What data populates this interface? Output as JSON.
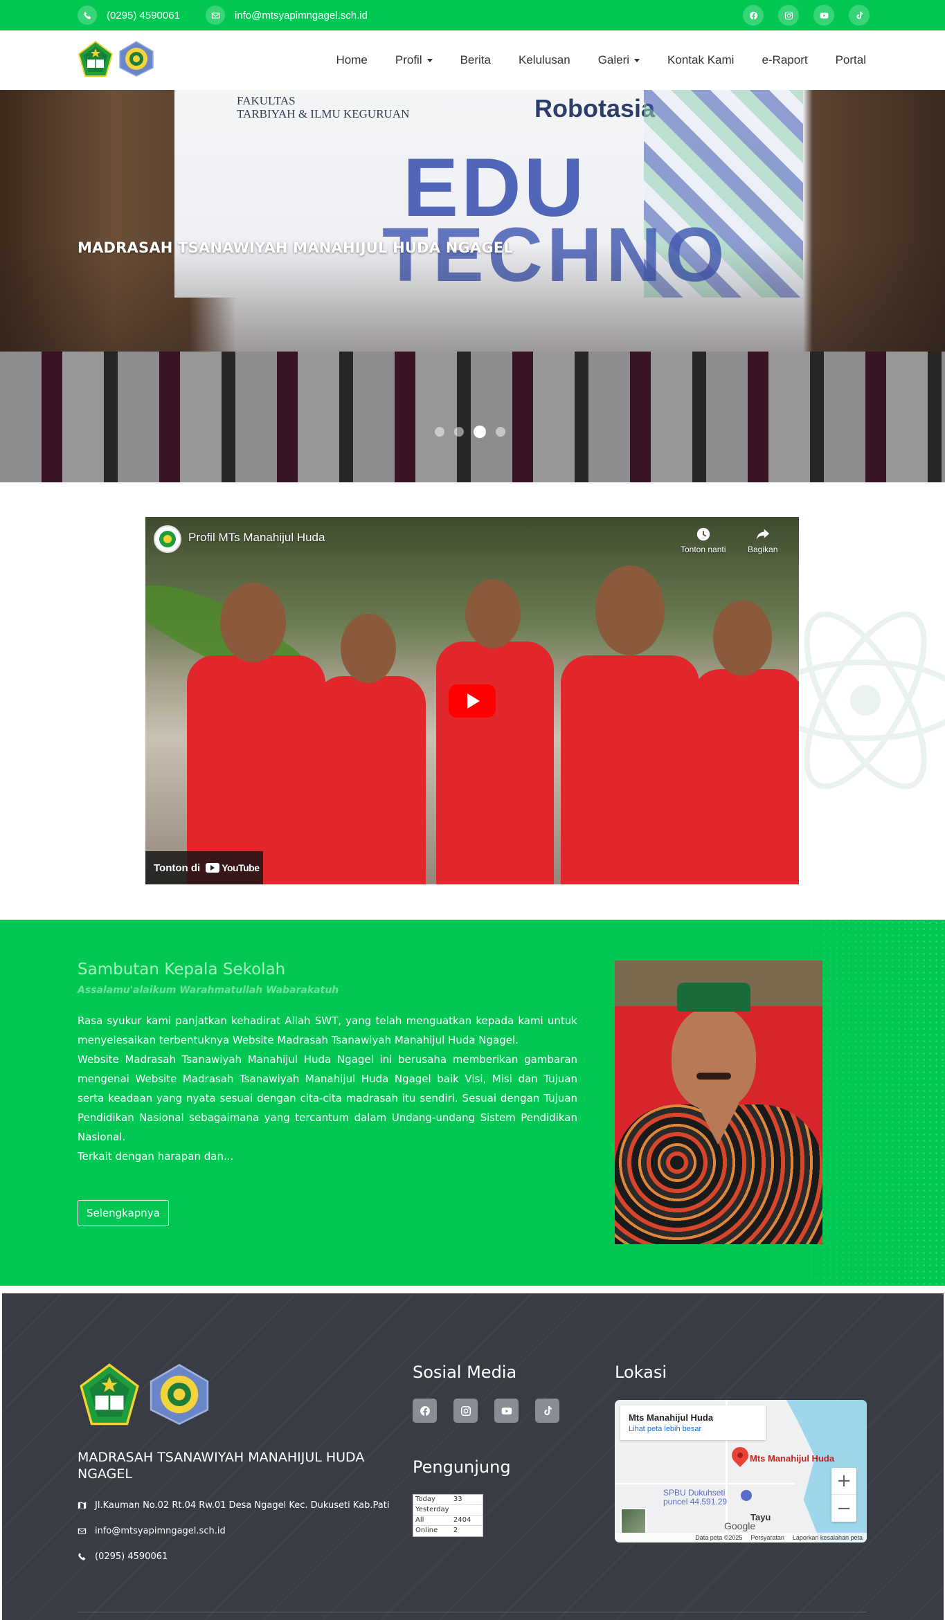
{
  "topbar": {
    "phone": "(0295) 4590061",
    "email": "info@mtsyapimngagel.sch.id",
    "social_icons": [
      "facebook-icon",
      "instagram-icon",
      "youtube-icon",
      "tiktok-icon"
    ]
  },
  "nav": {
    "items": [
      {
        "label": "Home",
        "dropdown": false
      },
      {
        "label": "Profil",
        "dropdown": true
      },
      {
        "label": "Berita",
        "dropdown": false
      },
      {
        "label": "Kelulusan",
        "dropdown": false
      },
      {
        "label": "Galeri",
        "dropdown": true
      },
      {
        "label": "Kontak Kami",
        "dropdown": false
      },
      {
        "label": "e-Raport",
        "dropdown": false
      },
      {
        "label": "Portal",
        "dropdown": false
      }
    ]
  },
  "hero": {
    "caption": "MADRASAH TSANAWIYAH MANAHIJUL HUDA NGAGEL",
    "banner_faculty": "FAKULTAS\nTARBIYAH & ILMU KEGURUAN",
    "banner_brand": "Robotasia",
    "banner_edu": "EDU",
    "banner_techno": "TECHNO",
    "slides_total": 4,
    "active_slide": 3
  },
  "video": {
    "title": "Profil MTs Manahijul Huda",
    "watch_later": "Tonton nanti",
    "share": "Bagikan",
    "watch_on": "Tonton di",
    "youtube": "YouTube"
  },
  "sambutan": {
    "title": "Sambutan Kepala Sekolah",
    "greeting": "Assalamu'alaikum Warahmatullah Wabarakatuh",
    "paragraphs": [
      "Rasa syukur kami panjatkan kehadirat Allah SWT, yang telah menguatkan kepada kami untuk menyelesaikan terbentuknya Website Madrasah Tsanawiyah Manahijul Huda Ngagel.",
      "Website Madrasah Tsanawiyah Manahijul Huda Ngagel ini berusaha memberikan gambaran mengenai Website Madrasah Tsanawiyah Manahijul Huda Ngagel baik Visi, Misi dan Tujuan serta keadaan yang nyata sesuai dengan cita-cita madrasah itu sendiri. Sesuai dengan Tujuan Pendidikan Nasional sebagaimana yang tercantum dalam Undang-undang Sistem Pendidikan Nasional.",
      "Terkait dengan harapan dan..."
    ],
    "button": "Selengkapnya"
  },
  "footer": {
    "school_name": "MADRASAH TSANAWIYAH MANAHIJUL HUDA NGAGEL",
    "address": "Jl.Kauman No.02 Rt.04 Rw.01 Desa Ngagel Kec. Dukuseti Kab.Pati",
    "email": "info@mtsyapimngagel.sch.id",
    "phone": "(0295) 4590061",
    "social_title": "Sosial Media",
    "visitor_title": "Pengunjung",
    "visitors": [
      {
        "label": "Today",
        "value": "33"
      },
      {
        "label": "Yesterday",
        "value": ""
      },
      {
        "label": "All",
        "value": "2404"
      },
      {
        "label": "Online",
        "value": "2"
      }
    ],
    "location_title": "Lokasi",
    "map": {
      "place": "Mts Manahijul Huda",
      "link": "Lihat peta lebih besar",
      "pin_label": "Mts Manahijul Huda",
      "poi": "SPBU Dukuhseti\npuncel 44.591.29",
      "town": "Tayu",
      "google": "Google",
      "attribution": [
        "Data peta ©2025",
        "Persyaratan",
        "Laporkan kesalahan peta"
      ]
    }
  },
  "colors": {
    "brand_green": "#00c853",
    "footer_bg": "#393b45"
  }
}
